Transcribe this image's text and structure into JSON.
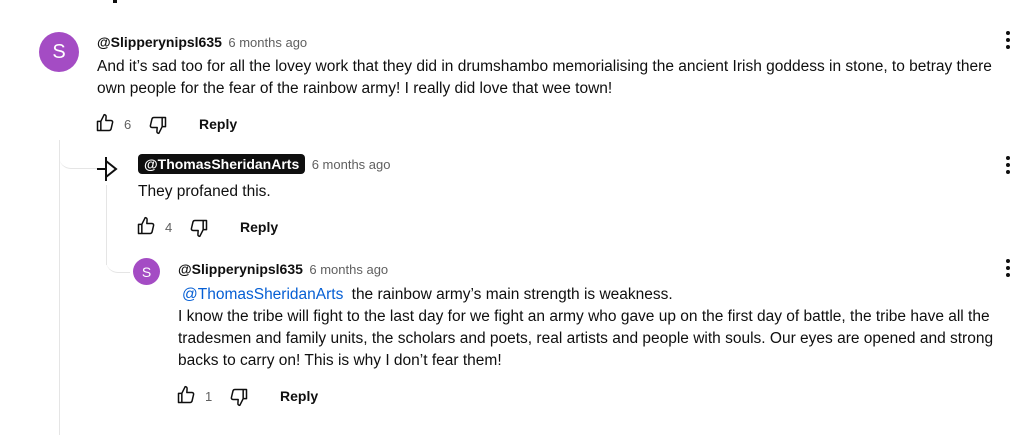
{
  "comments": [
    {
      "avatar_letter": "S",
      "author": "@Slipperynipsl635",
      "time": "6 months ago",
      "text": "And it’s sad too for all the lovey work that they did in drumshambo memorialising the ancient Irish goddess in stone, to betray there own people for the fear of the rainbow army! I really did love that wee town!",
      "likes": "6",
      "reply_label": "Reply"
    },
    {
      "author": "@ThomasSheridanArts",
      "time": "6 months ago",
      "text": "They profaned this.",
      "likes": "4",
      "reply_label": "Reply"
    },
    {
      "avatar_letter": "S",
      "author": "@Slipperynipsl635",
      "time": "6 months ago",
      "mention": "@ThomasSheridanArts",
      "text_first": " the rainbow army’s main strength is weakness.",
      "text_rest": "I know the tribe will fight to the last day for we fight an army who gave up on the first day of battle, the tribe have all the tradesmen and family units, the scholars and poets, real artists and people with souls. Our eyes are opened and strong backs to carry on! This is why I don’t fear them!",
      "likes": "1",
      "reply_label": "Reply"
    }
  ],
  "colors": {
    "avatar": "#a44cc4",
    "mention": "#065fd4",
    "owner_badge": "#0f0f0f"
  },
  "icons": [
    "thumb-up-icon",
    "thumb-down-icon",
    "more-vert-icon",
    "owner-sigil-icon"
  ]
}
